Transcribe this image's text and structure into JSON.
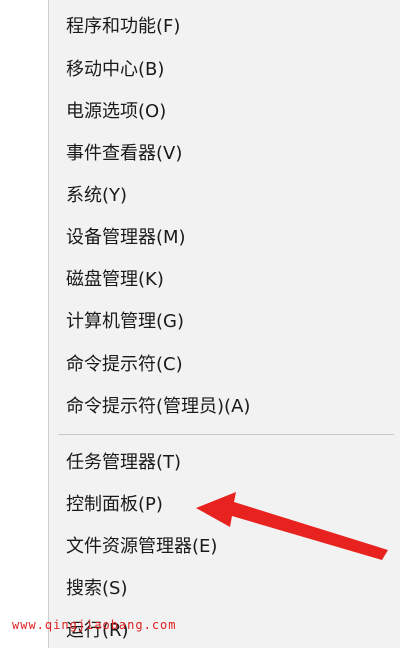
{
  "menu": {
    "group1": [
      {
        "label": "程序和功能(F)"
      },
      {
        "label": "移动中心(B)"
      },
      {
        "label": "电源选项(O)"
      },
      {
        "label": "事件查看器(V)"
      },
      {
        "label": "系统(Y)"
      },
      {
        "label": "设备管理器(M)"
      },
      {
        "label": "磁盘管理(K)"
      },
      {
        "label": "计算机管理(G)"
      },
      {
        "label": "命令提示符(C)"
      },
      {
        "label": "命令提示符(管理员)(A)"
      }
    ],
    "group2": [
      {
        "label": "任务管理器(T)"
      },
      {
        "label": "控制面板(P)"
      },
      {
        "label": "文件资源管理器(E)"
      },
      {
        "label": "搜索(S)"
      },
      {
        "label": "运行(R)"
      }
    ]
  },
  "annotation": {
    "arrow_color": "#e8231f",
    "icon": "red-arrow-icon"
  },
  "watermark": {
    "text": "www.qingjiaobang.com",
    "color": "#e02020"
  }
}
